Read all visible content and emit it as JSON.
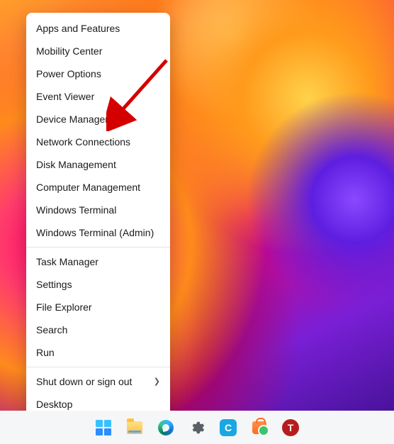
{
  "menu": {
    "groups": [
      [
        {
          "id": "apps-and-features",
          "label": "Apps and Features"
        },
        {
          "id": "mobility-center",
          "label": "Mobility Center"
        },
        {
          "id": "power-options",
          "label": "Power Options"
        },
        {
          "id": "event-viewer",
          "label": "Event Viewer"
        },
        {
          "id": "device-manager",
          "label": "Device Manager"
        },
        {
          "id": "network-connections",
          "label": "Network Connections"
        },
        {
          "id": "disk-management",
          "label": "Disk Management"
        },
        {
          "id": "computer-management",
          "label": "Computer Management"
        },
        {
          "id": "windows-terminal",
          "label": "Windows Terminal"
        },
        {
          "id": "windows-terminal-admin",
          "label": "Windows Terminal (Admin)"
        }
      ],
      [
        {
          "id": "task-manager",
          "label": "Task Manager"
        },
        {
          "id": "settings",
          "label": "Settings"
        },
        {
          "id": "file-explorer",
          "label": "File Explorer"
        },
        {
          "id": "search",
          "label": "Search"
        },
        {
          "id": "run",
          "label": "Run"
        }
      ],
      [
        {
          "id": "shut-down",
          "label": "Shut down or sign out",
          "submenu": true
        },
        {
          "id": "desktop",
          "label": "Desktop"
        }
      ]
    ]
  },
  "annotation": {
    "target_menu_id": "device-manager"
  },
  "taskbar": {
    "items": [
      {
        "icon": "start-icon",
        "name": "Start"
      },
      {
        "icon": "file-explorer-icon",
        "name": "File Explorer"
      },
      {
        "icon": "edge-icon",
        "name": "Microsoft Edge"
      },
      {
        "icon": "settings-icon",
        "name": "Settings"
      },
      {
        "icon": "c-app-icon",
        "name": "C",
        "letter": "C"
      },
      {
        "icon": "store-icon",
        "name": "Microsoft Store"
      },
      {
        "icon": "t-app-icon",
        "name": "T",
        "letter": "T"
      }
    ]
  }
}
